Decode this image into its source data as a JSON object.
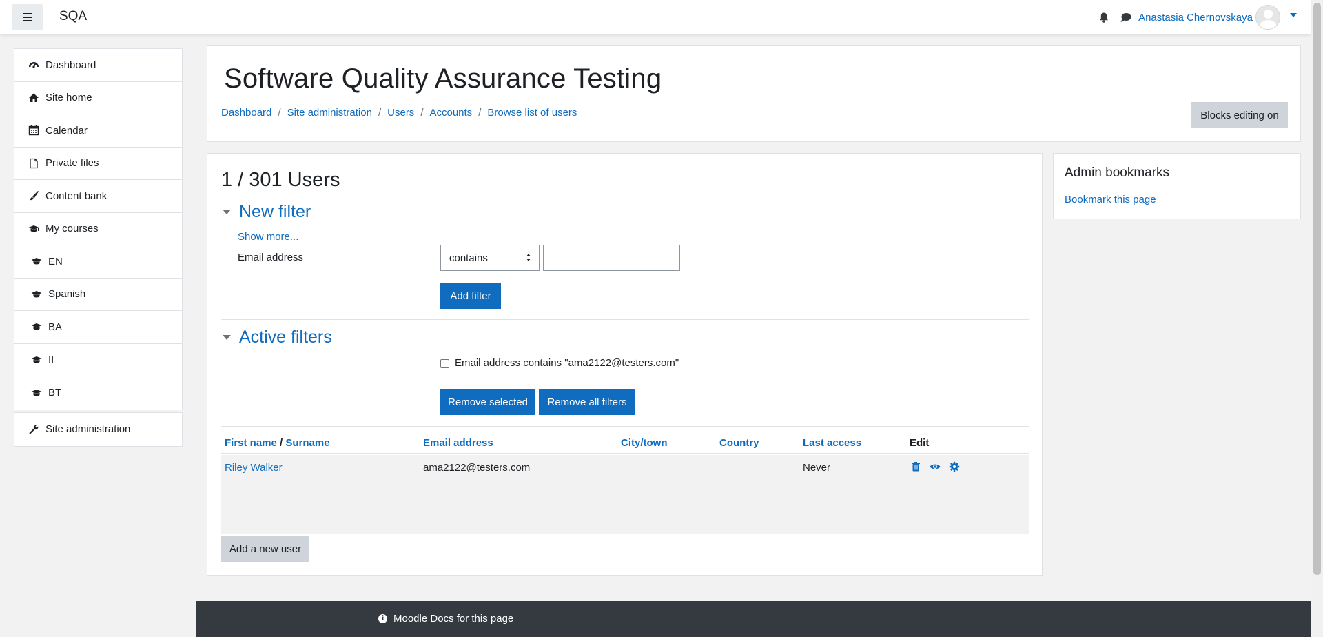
{
  "brand": "SQA",
  "header_user": "Anastasia Chernovskaya",
  "nav": {
    "group1": [
      {
        "label": "Dashboard",
        "icon": "dashboard-icon"
      },
      {
        "label": "Site home",
        "icon": "home-icon"
      },
      {
        "label": "Calendar",
        "icon": "calendar-icon"
      },
      {
        "label": "Private files",
        "icon": "file-icon"
      },
      {
        "label": "Content bank",
        "icon": "paintbrush-icon"
      },
      {
        "label": "My courses",
        "icon": "graduation-cap-icon"
      },
      {
        "label": "EN",
        "icon": "graduation-cap-icon"
      },
      {
        "label": "Spanish",
        "icon": "graduation-cap-icon"
      },
      {
        "label": "BA",
        "icon": "graduation-cap-icon"
      },
      {
        "label": "II",
        "icon": "graduation-cap-icon"
      },
      {
        "label": "BT",
        "icon": "graduation-cap-icon"
      }
    ],
    "group2": [
      {
        "label": "Site administration",
        "icon": "wrench-icon"
      }
    ]
  },
  "page": {
    "heading": "Software Quality Assurance Testing",
    "breadcrumb": [
      "Dashboard",
      "Site administration",
      "Users",
      "Accounts",
      "Browse list of users"
    ],
    "blocks_button": "Blocks editing on"
  },
  "main": {
    "users_count": "1 / 301 Users",
    "new_filter": {
      "heading": "New filter",
      "show_more": "Show more...",
      "field_label": "Email address",
      "operator": "contains",
      "value": "",
      "add_button": "Add filter"
    },
    "active_filters": {
      "heading": "Active filters",
      "filter_text": "Email address contains \"ama2122@testers.com\"",
      "checked": false,
      "remove_selected": "Remove selected",
      "remove_all": "Remove all filters"
    },
    "table": {
      "headers": {
        "first_name": "First name",
        "name_sep": " / ",
        "surname": "Surname",
        "email": "Email address",
        "city": "City/town",
        "country": "Country",
        "last_access": "Last access",
        "edit": "Edit"
      },
      "rows": [
        {
          "name": "Riley Walker",
          "email": "ama2122@testers.com",
          "city": "",
          "country": "",
          "last_access": "Never"
        }
      ]
    },
    "add_user_button": "Add a new user"
  },
  "bookmarks": {
    "title": "Admin bookmarks",
    "link": "Bookmark this page"
  },
  "footer": {
    "docs_link": "Moodle Docs for this page"
  },
  "colors": {
    "primary": "#0f6cbf",
    "secondary_button": "#ced4da",
    "footer_bg": "#343a40"
  }
}
